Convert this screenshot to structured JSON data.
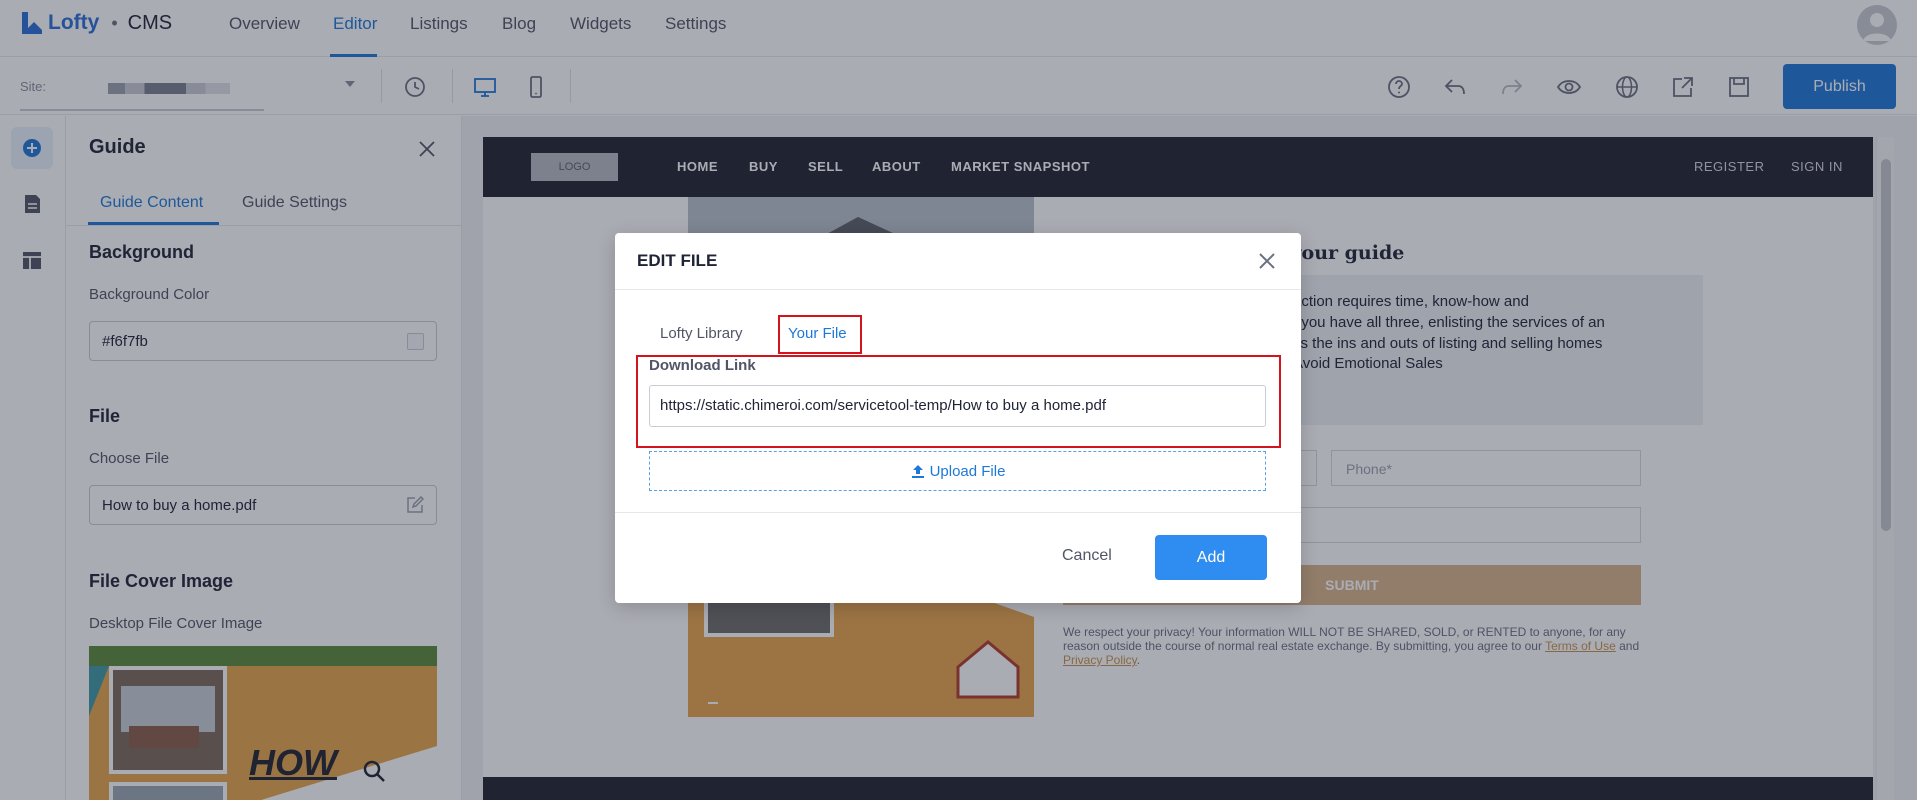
{
  "app": {
    "brand": "Lofty",
    "product": "CMS",
    "separator": "•"
  },
  "nav": {
    "items": [
      {
        "label": "Overview"
      },
      {
        "label": "Editor"
      },
      {
        "label": "Listings"
      },
      {
        "label": "Blog"
      },
      {
        "label": "Widgets"
      },
      {
        "label": "Settings"
      }
    ],
    "active_item": "Editor"
  },
  "toolbar": {
    "site_label": "Site:",
    "publish_label": "Publish",
    "icons": [
      "history-icon",
      "desktop-icon",
      "mobile-icon",
      "help-icon",
      "undo-icon",
      "redo-icon",
      "preview-icon",
      "globe-icon",
      "export-icon",
      "save-icon"
    ]
  },
  "rail": {
    "icons": [
      "add-icon",
      "page-icon",
      "layout-icon"
    ]
  },
  "panel": {
    "title": "Guide",
    "tabs": [
      {
        "label": "Guide Content"
      },
      {
        "label": "Guide Settings"
      }
    ],
    "sections": {
      "background": {
        "title": "Background",
        "color_label": "Background Color",
        "color_value": "#f6f7fb"
      },
      "file": {
        "title": "File",
        "choose_label": "Choose File",
        "file_value": "How to buy a home.pdf"
      },
      "cover": {
        "title": "File Cover Image",
        "desktop_label": "Desktop File Cover Image",
        "cover_text": "HOW"
      }
    }
  },
  "preview": {
    "logo": "LOGO",
    "nav": [
      "HOME",
      "BUY",
      "SELL",
      "ABOUT",
      "MARKET SNAPSHOT"
    ],
    "nav_right": [
      "REGISTER",
      "SIGN IN"
    ],
    "form_title": "et your guide",
    "form_lines": [
      "action requires time, know-how and",
      "t you have all three, enlisting the services of an",
      "vs the ins and outs of listing and selling homes",
      "Avoid Emotional Sales",
      "s"
    ],
    "phone_placeholder": "Phone*",
    "submit_label": "SUBMIT",
    "privacy_text": "We respect your privacy! Your information WILL NOT BE SHARED, SOLD, or RENTED to anyone, for any reason outside the course of normal real estate exchange. By submitting, you agree to our",
    "terms_link": "Terms of Use",
    "and_text": "and",
    "privacy_link": "Privacy Policy",
    "privacy_end": "."
  },
  "modal": {
    "title": "EDIT FILE",
    "tabs": [
      {
        "label": "Lofty Library"
      },
      {
        "label": "Your File"
      }
    ],
    "active_tab": "Your File",
    "download_label": "Download Link",
    "download_value": "https://static.chimeroi.com/servicetool-temp/How to buy a home.pdf",
    "upload_label": "Upload File",
    "cancel_label": "Cancel",
    "add_label": "Add"
  },
  "colors": {
    "accent": "#1e78d7",
    "highlight": "#d4141c",
    "dark_header": "#21232f",
    "submit": "#d9b48a"
  }
}
